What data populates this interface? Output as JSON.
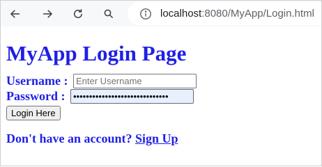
{
  "browser": {
    "url_host": "localhost",
    "url_rest": ":8080/MyApp/Login.html",
    "icons": [
      "back-icon",
      "forward-icon",
      "reload-icon",
      "search-icon",
      "info-icon"
    ]
  },
  "page": {
    "title": "MyApp Login Page",
    "username_label": "Username :",
    "username_placeholder": "Enter Username",
    "username_value": "",
    "password_label": "Password :",
    "password_value": "••••••••••••••••••••••••••••••",
    "login_button": "Login Here",
    "signup_prompt": "Don't have an account?",
    "signup_link": "Sign Up"
  },
  "colors": {
    "heading": "#1f1fe5",
    "autofill_bg": "#e8f0fe"
  }
}
